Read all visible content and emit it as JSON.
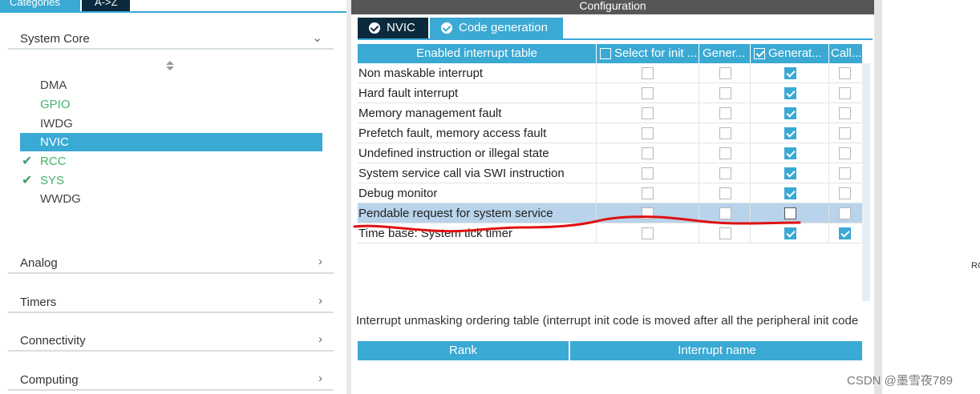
{
  "left_panel": {
    "tabs": {
      "categories": "Categories",
      "az": "A->Z"
    },
    "system_core": {
      "title": "System Core",
      "items": [
        {
          "label": "DMA",
          "state": "plain"
        },
        {
          "label": "GPIO",
          "state": "green"
        },
        {
          "label": "IWDG",
          "state": "plain"
        },
        {
          "label": "NVIC",
          "state": "selected"
        },
        {
          "label": "RCC",
          "state": "checked"
        },
        {
          "label": "SYS",
          "state": "checked"
        },
        {
          "label": "WWDG",
          "state": "plain"
        }
      ]
    },
    "categories": [
      "Analog",
      "Timers",
      "Connectivity",
      "Computing"
    ]
  },
  "config_panel": {
    "title": "Configuration",
    "tabs": {
      "nvic": "NVIC",
      "code_generation": "Code generation"
    },
    "table": {
      "headers": [
        "Enabled interrupt table",
        "Select for init ...",
        "Gener...",
        "Generat...",
        "Call..."
      ],
      "rows": [
        {
          "name": "Non maskable interrupt",
          "checks": [
            false,
            false,
            true,
            false
          ]
        },
        {
          "name": "Hard fault interrupt",
          "checks": [
            false,
            false,
            true,
            false
          ]
        },
        {
          "name": "Memory management fault",
          "checks": [
            false,
            false,
            true,
            false
          ]
        },
        {
          "name": "Prefetch fault, memory access fault",
          "checks": [
            false,
            false,
            true,
            false
          ]
        },
        {
          "name": "Undefined instruction or illegal state",
          "checks": [
            false,
            false,
            true,
            false
          ]
        },
        {
          "name": "System service call via SWI instruction",
          "checks": [
            false,
            false,
            true,
            false
          ]
        },
        {
          "name": "Debug monitor",
          "checks": [
            false,
            false,
            true,
            false
          ]
        },
        {
          "name": "Pendable request for system service",
          "checks": [
            false,
            false,
            false,
            false
          ],
          "highlighted": true
        },
        {
          "name": "Time base: System tick timer",
          "checks": [
            false,
            false,
            true,
            true
          ]
        }
      ]
    },
    "ordering_caption": "Interrupt unmasking ordering table (interrupt init code is moved after all the peripheral init code",
    "ordering_headers": {
      "rank": "Rank",
      "name": "Interrupt name"
    }
  },
  "edge_text": "RC",
  "watermark": "CSDN @墨雪夜789",
  "colors": {
    "accent": "#3aa9d4",
    "dark_tab": "#0b2a3d",
    "title_bar": "#565656",
    "annotation": "#e01010",
    "ok_green": "#45b26b"
  }
}
